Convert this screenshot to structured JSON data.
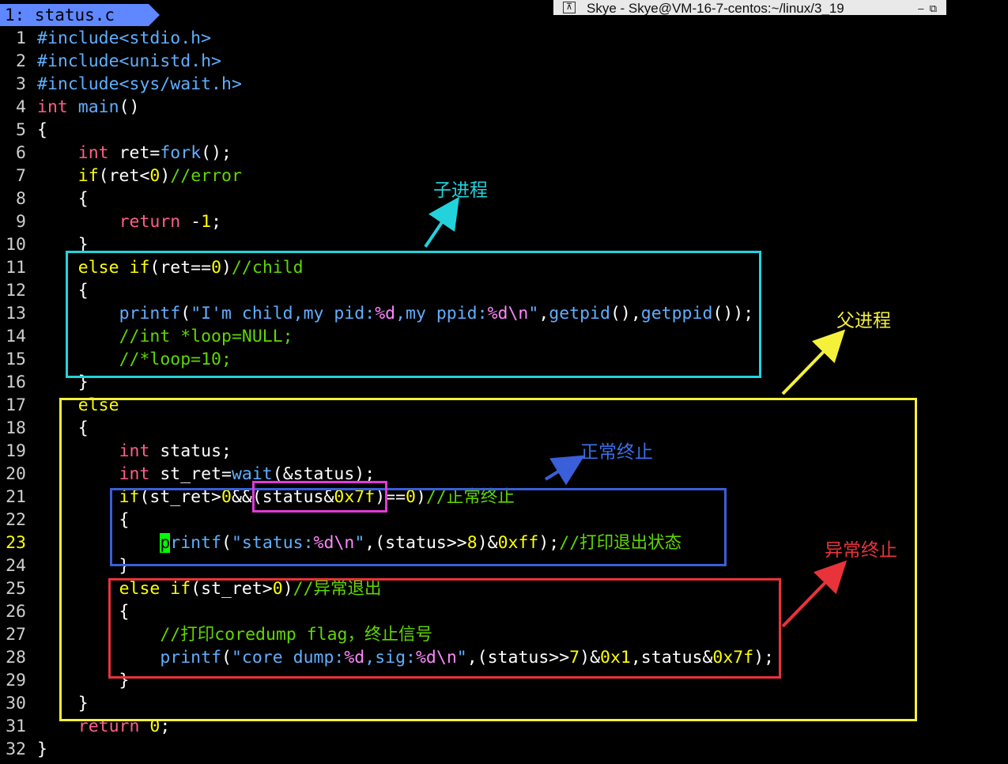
{
  "tab": {
    "label": "1: status.c"
  },
  "window": {
    "title": "Skye - Skye@VM-16-7-centos:~/linux/3_19"
  },
  "editor": {
    "current_line": "23",
    "lines": [
      {
        "n": "1",
        "t": "#include<stdio.h>"
      },
      {
        "n": "2",
        "t": "#include<unistd.h>"
      },
      {
        "n": "3",
        "t": "#include<sys/wait.h>"
      },
      {
        "n": "4",
        "t": "int main()"
      },
      {
        "n": "5",
        "t": "{"
      },
      {
        "n": "6",
        "t": "    int ret=fork();"
      },
      {
        "n": "7",
        "t": "    if(ret<0)//error"
      },
      {
        "n": "8",
        "t": "    {"
      },
      {
        "n": "9",
        "t": "        return -1;"
      },
      {
        "n": "10",
        "t": "    }"
      },
      {
        "n": "11",
        "t": "    else if(ret==0)//child"
      },
      {
        "n": "12",
        "t": "    {"
      },
      {
        "n": "13",
        "t": "        printf(\"I'm child,my pid:%d,my ppid:%d\\n\",getpid(),getppid());"
      },
      {
        "n": "14",
        "t": "        //int *loop=NULL;"
      },
      {
        "n": "15",
        "t": "        //*loop=10;"
      },
      {
        "n": "16",
        "t": "    }"
      },
      {
        "n": "17",
        "t": "    else"
      },
      {
        "n": "18",
        "t": "    {"
      },
      {
        "n": "19",
        "t": "        int status;"
      },
      {
        "n": "20",
        "t": "        int st_ret=wait(&status);"
      },
      {
        "n": "21",
        "t": "        if(st_ret>0&&(status&0x7f)==0)//正常终止"
      },
      {
        "n": "22",
        "t": "        {"
      },
      {
        "n": "23",
        "t": "            printf(\"status:%d\\n\",(status>>8)&0xff);//打印退出状态"
      },
      {
        "n": "24",
        "t": "        }"
      },
      {
        "n": "25",
        "t": "        else if(st_ret>0)//异常退出"
      },
      {
        "n": "26",
        "t": "        {"
      },
      {
        "n": "27",
        "t": "            //打印coredump flag，终止信号"
      },
      {
        "n": "28",
        "t": "            printf(\"core dump:%d,sig:%d\\n\",(status>>7)&0x1,status&0x7f);"
      },
      {
        "n": "29",
        "t": "        }"
      },
      {
        "n": "30",
        "t": "    }"
      },
      {
        "n": "31",
        "t": "    return 0;"
      },
      {
        "n": "32",
        "t": "}"
      }
    ]
  },
  "annotations": {
    "child_label": "子进程",
    "parent_label": "父进程",
    "normal_exit_label": "正常终止",
    "abnormal_exit_label": "异常终止",
    "colors": {
      "cyan": "#22d3dc",
      "yellow": "#f5f03a",
      "blue": "#3a5fd8",
      "magenta": "#e13ad8",
      "red": "#e8333a"
    }
  }
}
